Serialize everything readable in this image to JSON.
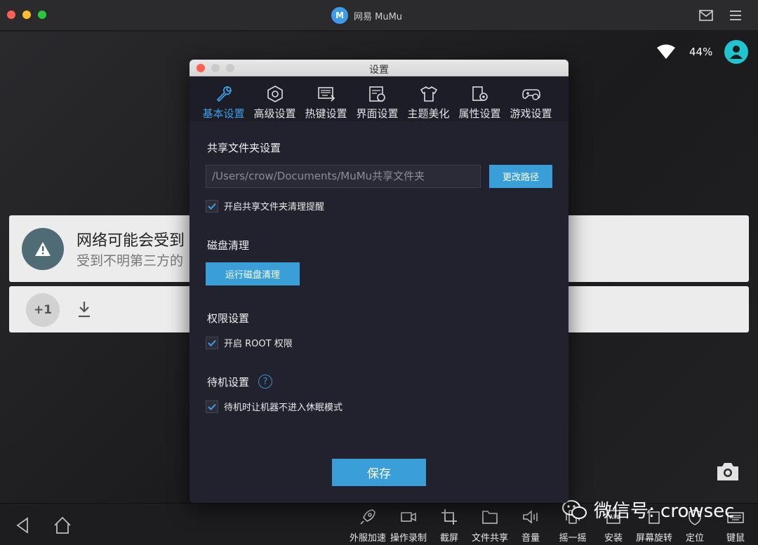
{
  "window": {
    "title": "网易 MuMu",
    "logo_text": "M"
  },
  "android": {
    "battery": "44%",
    "notice": {
      "title": "网络可能会受到",
      "subtitle": "受到不明第三方的"
    },
    "plus_one": "+1"
  },
  "dialog": {
    "title": "设置",
    "tabs": [
      {
        "label": "基本设置",
        "icon": "wrench-icon",
        "active": true
      },
      {
        "label": "高级设置",
        "icon": "hexagon-nut-icon"
      },
      {
        "label": "热键设置",
        "icon": "keyboard-icon"
      },
      {
        "label": "界面设置",
        "icon": "screen-settings-icon"
      },
      {
        "label": "主题美化",
        "icon": "tshirt-icon"
      },
      {
        "label": "属性设置",
        "icon": "device-settings-icon"
      },
      {
        "label": "游戏设置",
        "icon": "gamepad-icon"
      }
    ],
    "shared_folder": {
      "title": "共享文件夹设置",
      "path": "/Users/crow/Documents/MuMu共享文件夹",
      "change_button": "更改路径",
      "cleanup_reminder": "开启共享文件夹清理提醒"
    },
    "disk_cleanup": {
      "title": "磁盘清理",
      "run_button": "运行磁盘清理"
    },
    "permissions": {
      "title": "权限设置",
      "root_label": "开启 ROOT 权限"
    },
    "standby": {
      "title": "待机设置",
      "help": "?",
      "no_sleep_label": "待机时让机器不进入休眠模式"
    },
    "save_button": "保存"
  },
  "toolbar": {
    "tools": [
      {
        "label": "外服加速",
        "icon": "rocket-icon"
      },
      {
        "label": "操作录制",
        "icon": "video-record-icon"
      },
      {
        "label": "截屏",
        "icon": "crop-icon"
      },
      {
        "label": "文件共享",
        "icon": "folder-icon"
      },
      {
        "label": "音量",
        "icon": "volume-icon"
      },
      {
        "label": "摇一摇",
        "icon": "shake-icon"
      },
      {
        "label": "安装",
        "icon": "apk-icon"
      },
      {
        "label": "屏幕旋转",
        "icon": "rotate-icon"
      },
      {
        "label": "定位",
        "icon": "location-icon"
      },
      {
        "label": "键鼠",
        "icon": "keyboard-mouse-icon"
      }
    ]
  },
  "watermark": {
    "text": "微信号: crowsec"
  },
  "colors": {
    "accent": "#3a9fd8",
    "dialog_bg": "#21222d",
    "avatar": "#20c4cf"
  }
}
